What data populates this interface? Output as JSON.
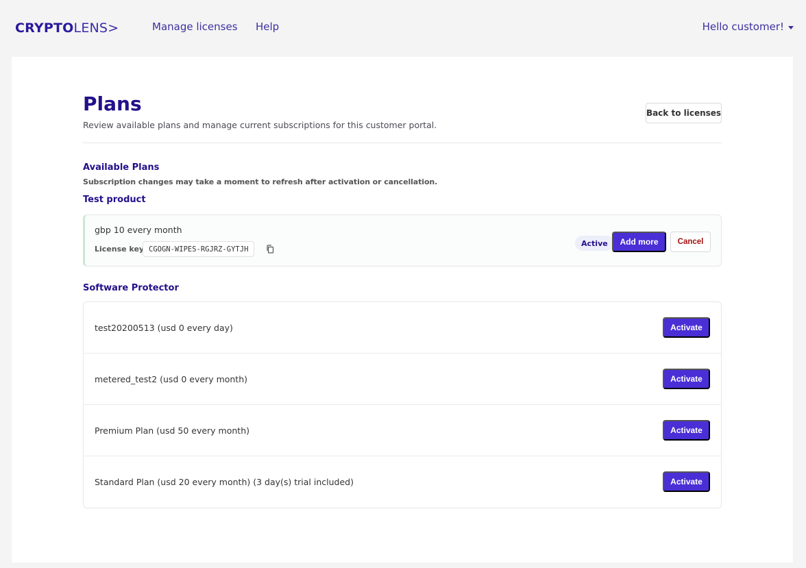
{
  "header": {
    "logo_bold": "CRYPTO",
    "logo_light": "LENS>",
    "nav": [
      "Manage licenses",
      "Help"
    ],
    "user_greeting": "Hello customer!"
  },
  "page": {
    "title": "Plans",
    "subtitle": "Review available plans and manage current subscriptions for this customer portal.",
    "back_button": "Back to licenses"
  },
  "available": {
    "title": "Available Plans",
    "note": "Subscription changes may take a moment to refresh after activation or cancellation."
  },
  "products": [
    {
      "name": "Test product",
      "active_plan": {
        "description": "gbp 10 every month",
        "license_key_label": "License key",
        "license_key": "CGOGN-WIPES-RGJRZ-GYTJH",
        "status": "Active",
        "add_more_label": "Add more",
        "cancel_label": "Cancel"
      }
    },
    {
      "name": "Software Protector",
      "plans": [
        {
          "description": "test20200513 (usd 0 every day)",
          "action": "Activate"
        },
        {
          "description": "metered_test2 (usd 0 every month)",
          "action": "Activate"
        },
        {
          "description": "Premium Plan (usd 50 every month)",
          "action": "Activate"
        },
        {
          "description": "Standard Plan (usd 20 every month) (3 day(s) trial included)",
          "action": "Activate"
        }
      ]
    }
  ],
  "colors": {
    "brand": "#22108a",
    "primary_button": "#4a2ed6",
    "cancel_text": "#a31212",
    "page_bg": "#f4f4f4"
  }
}
